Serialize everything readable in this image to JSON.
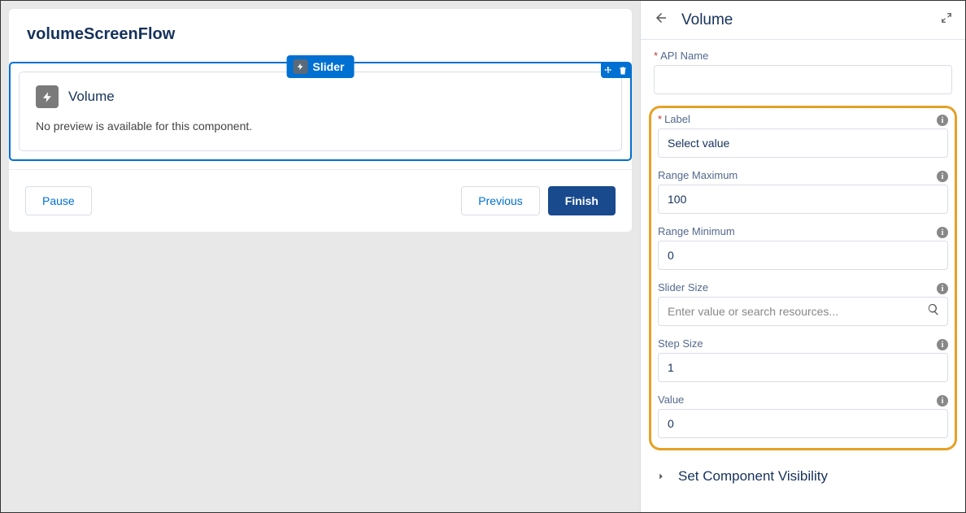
{
  "flow": {
    "title": "volumeScreenFlow"
  },
  "componentTag": {
    "label": "Slider"
  },
  "component": {
    "title": "Volume",
    "no_preview": "No preview is available for this component."
  },
  "footer": {
    "pause": "Pause",
    "previous": "Previous",
    "finish": "Finish"
  },
  "props": {
    "title": "Volume",
    "api_name": {
      "label": "API Name",
      "value": ""
    },
    "label": {
      "label": "Label",
      "value": "Select value"
    },
    "range_max": {
      "label": "Range Maximum",
      "value": "100"
    },
    "range_min": {
      "label": "Range Minimum",
      "value": "0"
    },
    "slider_size": {
      "label": "Slider Size",
      "placeholder": "Enter value or search resources..."
    },
    "step_size": {
      "label": "Step Size",
      "value": "1"
    },
    "value": {
      "label": "Value",
      "value": "0"
    },
    "visibility": "Set Component Visibility"
  }
}
